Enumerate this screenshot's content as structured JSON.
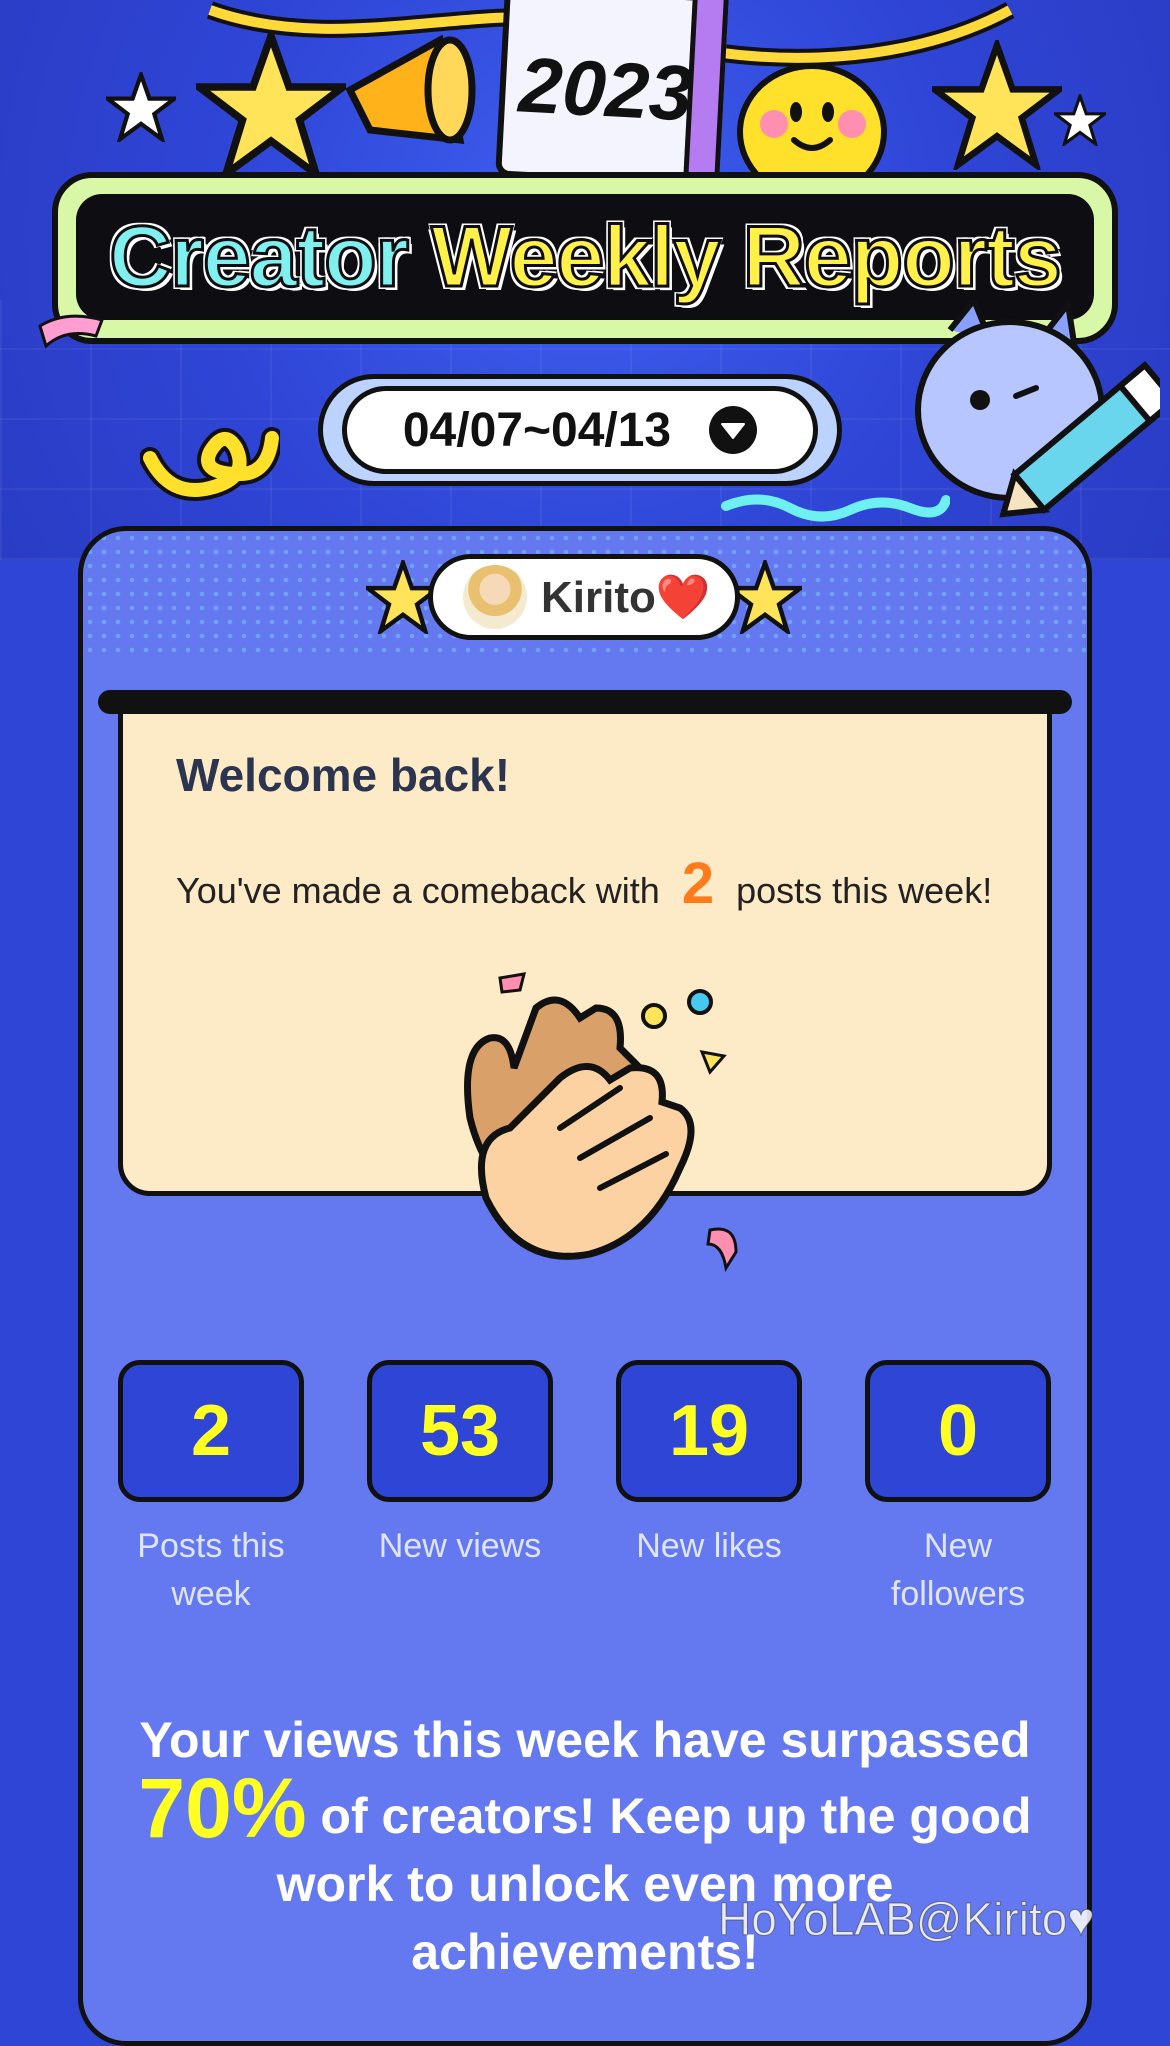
{
  "header": {
    "year": "2023",
    "title_part1": "Creator",
    "title_part2": "Weekly Reports",
    "date_range": "04/07~04/13"
  },
  "user": {
    "name": "Kirito❤️"
  },
  "welcome": {
    "title": "Welcome back!",
    "message_before": "You've made a comeback with",
    "posts_count": "2",
    "message_after": "posts this week!"
  },
  "stats": [
    {
      "value": "2",
      "label": "Posts this week"
    },
    {
      "value": "53",
      "label": "New views"
    },
    {
      "value": "19",
      "label": "New likes"
    },
    {
      "value": "0",
      "label": "New followers"
    }
  ],
  "summary": {
    "part1": "Your views this week have surpassed",
    "percent": "70%",
    "part2": "of creators! Keep up the good work to unlock even more achievements!"
  },
  "watermark": "HoYoLAB@Kirito♥",
  "colors": {
    "background": "#2f45d6",
    "card": "#6479f0",
    "accent_yellow": "#ffff22",
    "accent_orange": "#ff7a1a"
  }
}
